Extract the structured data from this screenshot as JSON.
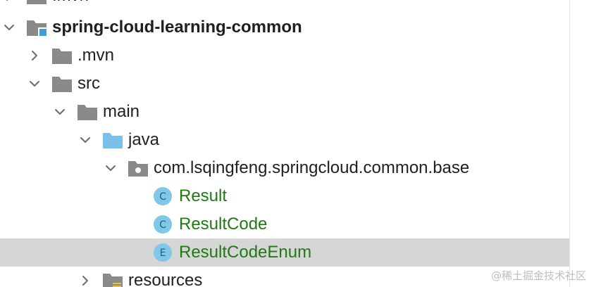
{
  "tree": {
    "partial_top_label": ".mvn",
    "module_label": "spring-cloud-learning-common",
    "mvn_folder_label": ".mvn",
    "src_folder_label": "src",
    "main_folder_label": "main",
    "java_folder_label": "java",
    "package_label": "com.lsqingfeng.springcloud.common.base",
    "class_result_label": "Result",
    "class_result_icon_letter": "C",
    "class_resultcode_label": "ResultCode",
    "class_resultcode_icon_letter": "C",
    "enum_resultcodeenum_label": "ResultCodeEnum",
    "enum_resultcodeenum_icon_letter": "E",
    "resources_folder_label": "resources"
  },
  "watermark": "@稀土掘金技术社区",
  "colors": {
    "selected_row": "#d6d6d6",
    "folder_gray": "#8a8a8a",
    "source_folder_blue": "#79c1ea",
    "class_icon_blue": "#7fc8e8",
    "enum_icon_blue": "#7fc8e8",
    "class_label_green": "#1d7b12"
  },
  "icons": {
    "collapsed_chevron": "chevron-right-icon",
    "expanded_chevron": "chevron-down-icon",
    "module": "module-folder-icon",
    "folder": "folder-icon",
    "source_folder": "source-folder-icon",
    "package": "package-icon",
    "class": "class-icon",
    "enum": "enum-icon",
    "resources": "resources-folder-icon"
  }
}
